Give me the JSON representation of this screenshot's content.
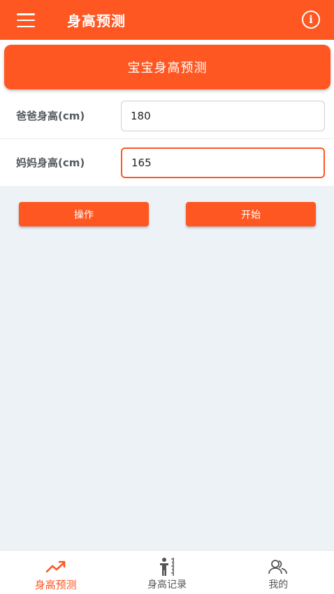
{
  "appbar": {
    "title": "身高预测",
    "menu_icon": "menu-icon",
    "info_icon": "info-icon",
    "info_glyph": "i"
  },
  "banner": {
    "title": "宝宝身高预测"
  },
  "form": {
    "father": {
      "label": "爸爸身高(cm)",
      "value": "180"
    },
    "mother": {
      "label": "妈妈身高(cm)",
      "value": "165"
    }
  },
  "buttons": {
    "operate": "操作",
    "start": "开始"
  },
  "bottom_nav": {
    "items": [
      {
        "label": "身高预测",
        "icon": "trend-up-icon",
        "active": true
      },
      {
        "label": "身高记录",
        "icon": "height-record-icon",
        "active": false
      },
      {
        "label": "我的",
        "icon": "users-icon",
        "active": false
      }
    ]
  },
  "colors": {
    "accent": "#fe5722",
    "background": "#edf2f6"
  }
}
